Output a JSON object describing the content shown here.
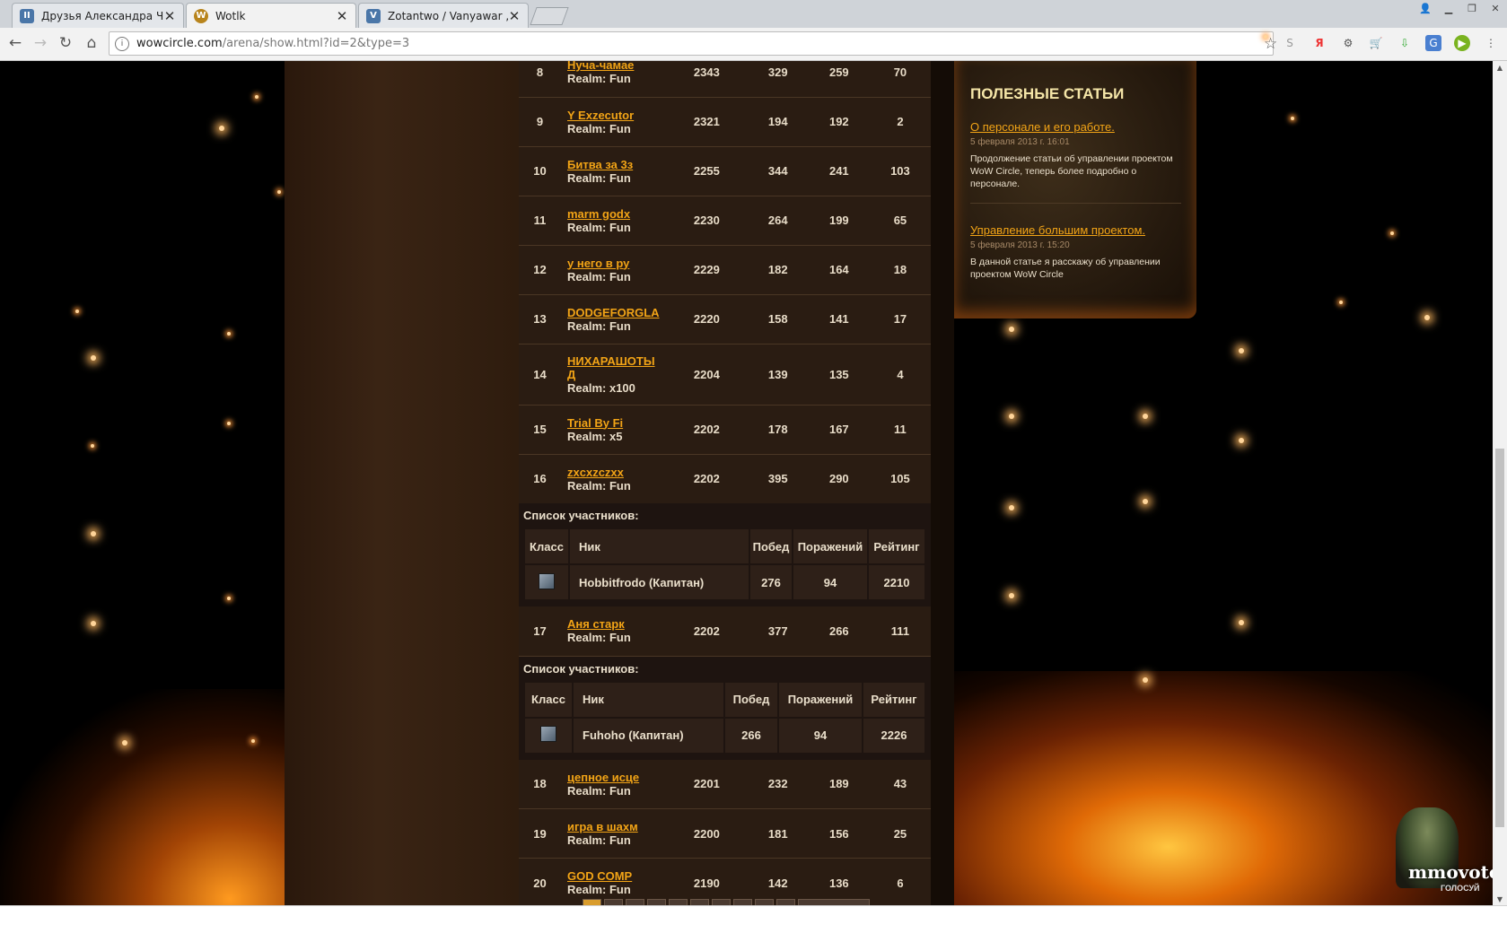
{
  "browser": {
    "tabs": [
      {
        "title": "Друзья Александра Чах",
        "icon": "vk-icon"
      },
      {
        "title": "Wotlk",
        "icon": "wow-icon"
      },
      {
        "title": "Zotantwo / Vanyawar , B",
        "icon": "vk-icon"
      }
    ],
    "url_host": "wowcircle.com",
    "url_path": "/arena/show.html?id=2&type=3"
  },
  "teams_top": [
    {
      "rank": "8",
      "name": "Нуча-чамае",
      "realm": "Realm: Fun",
      "rating": "2343",
      "games": "329",
      "wins": "259",
      "rank_pos": "70"
    },
    {
      "rank": "9",
      "name": "Y Exzecutor",
      "realm": "Realm: Fun",
      "rating": "2321",
      "games": "194",
      "wins": "192",
      "rank_pos": "2"
    },
    {
      "rank": "10",
      "name": "Битва за 3з",
      "realm": "Realm: Fun",
      "rating": "2255",
      "games": "344",
      "wins": "241",
      "rank_pos": "103"
    },
    {
      "rank": "11",
      "name": "marm godx",
      "realm": "Realm: Fun",
      "rating": "2230",
      "games": "264",
      "wins": "199",
      "rank_pos": "65"
    },
    {
      "rank": "12",
      "name": "у него в ру",
      "realm": "Realm: Fun",
      "rating": "2229",
      "games": "182",
      "wins": "164",
      "rank_pos": "18"
    },
    {
      "rank": "13",
      "name": "DODGEFORGLA",
      "realm": "Realm: Fun",
      "rating": "2220",
      "games": "158",
      "wins": "141",
      "rank_pos": "17"
    },
    {
      "rank": "14",
      "name": "НИХАРАШОТЫ Д",
      "realm": "Realm: x100",
      "rating": "2204",
      "games": "139",
      "wins": "135",
      "rank_pos": "4"
    },
    {
      "rank": "15",
      "name": "Trial By Fi",
      "realm": "Realm: x5",
      "rating": "2202",
      "games": "178",
      "wins": "167",
      "rank_pos": "11"
    },
    {
      "rank": "16",
      "name": "zxcxzczxx",
      "realm": "Realm: Fun",
      "rating": "2202",
      "games": "395",
      "wins": "290",
      "rank_pos": "105"
    }
  ],
  "members_1": {
    "caption": "Список участников:",
    "headers": [
      "Класс",
      "Ник",
      "Побед",
      "Поражений",
      "Рейтинг"
    ],
    "nick": "Hobbitfrodo (Капитан)",
    "wins": "276",
    "losses": "94",
    "rating": "2210"
  },
  "team_17": {
    "rank": "17",
    "name": "Аня старк",
    "realm": "Realm: Fun",
    "rating": "2202",
    "games": "377",
    "wins": "266",
    "rank_pos": "111"
  },
  "members_2": {
    "caption": "Список участников:",
    "headers": [
      "Класс",
      "Ник",
      "Побед",
      "Поражений",
      "Рейтинг"
    ],
    "nick": "Fuhoho (Капитан)",
    "wins": "266",
    "losses": "94",
    "rating": "2226"
  },
  "teams_bottom": [
    {
      "rank": "18",
      "name": "цепное исце",
      "realm": "Realm: Fun",
      "rating": "2201",
      "games": "232",
      "wins": "189",
      "rank_pos": "43"
    },
    {
      "rank": "19",
      "name": "игра в шахм",
      "realm": "Realm: Fun",
      "rating": "2200",
      "games": "181",
      "wins": "156",
      "rank_pos": "25"
    },
    {
      "rank": "20",
      "name": "GOD COMP",
      "realm": "Realm: Fun",
      "rating": "2190",
      "games": "142",
      "wins": "136",
      "rank_pos": "6"
    }
  ],
  "articles": {
    "heading": "ПОЛЕЗНЫЕ СТАТЬИ",
    "items": [
      {
        "title": "О персонале и его работе.",
        "date": "5 февраля 2013 г. 16:01",
        "desc": "Продолжение статьи об управлении проектом WoW Circle, теперь более подробно о персонале."
      },
      {
        "title": "Управление большим проектом.",
        "date": "5 февраля 2013 г. 15:20",
        "desc": "В данной статье я расскажу об управлении проектом WoW Circle"
      }
    ]
  },
  "mmovote": {
    "logo": "mmovote",
    "sub": "ГОЛОСУЙ"
  }
}
